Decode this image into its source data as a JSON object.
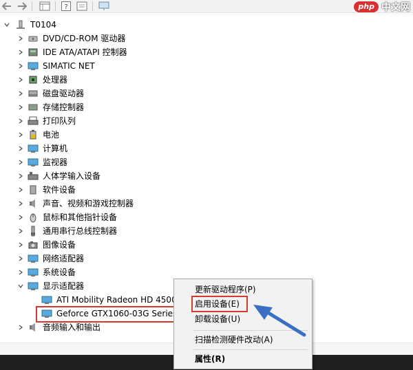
{
  "watermark": {
    "badge": "php",
    "text": "中文网"
  },
  "tree": {
    "root": "T0104",
    "categories": [
      "DVD/CD-ROM 驱动器",
      "IDE ATA/ATAPI 控制器",
      "SIMATIC NET",
      "处理器",
      "磁盘驱动器",
      "存储控制器",
      "打印队列",
      "电池",
      "计算机",
      "监视器",
      "人体学输入设备",
      "软件设备",
      "声音、视频和游戏控制器",
      "鼠标和其他指针设备",
      "通用串行总线控制器",
      "图像设备",
      "网络适配器",
      "系统设备",
      "显示适配器"
    ],
    "display_children": [
      "ATI Mobility Radeon HD 4500",
      "Geforce GTX1060-03G Series"
    ],
    "after": "音频输入和输出"
  },
  "context_menu": {
    "items": [
      "更新驱动程序(P)",
      "启用设备(E)",
      "卸载设备(U)",
      "扫描检测硬件改动(A)",
      "属性(R)"
    ]
  },
  "colors": {
    "highlight": "#d23a2f",
    "arrow": "#3a6fc4"
  }
}
